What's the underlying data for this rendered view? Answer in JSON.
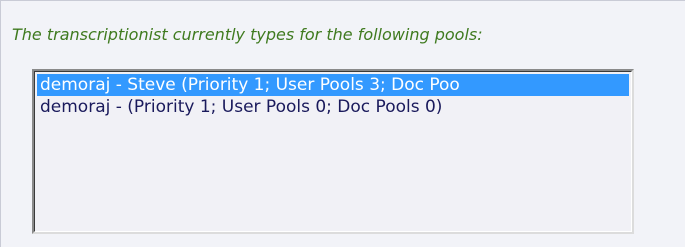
{
  "caption": "The transcriptionist currently types for the following pools:",
  "pools_list": {
    "options": [
      {
        "label": "demoraj - Steve (Priority 1; User Pools 3; Doc Poo",
        "selected": true
      },
      {
        "label": "demoraj - (Priority 1; User Pools 0; Doc Pools 0)",
        "selected": false
      }
    ]
  },
  "colors": {
    "caption_text": "#3f7a1f",
    "selection_bg": "#3399ff",
    "option_text": "#1a1a5c",
    "panel_bg": "#f2f3f8"
  }
}
